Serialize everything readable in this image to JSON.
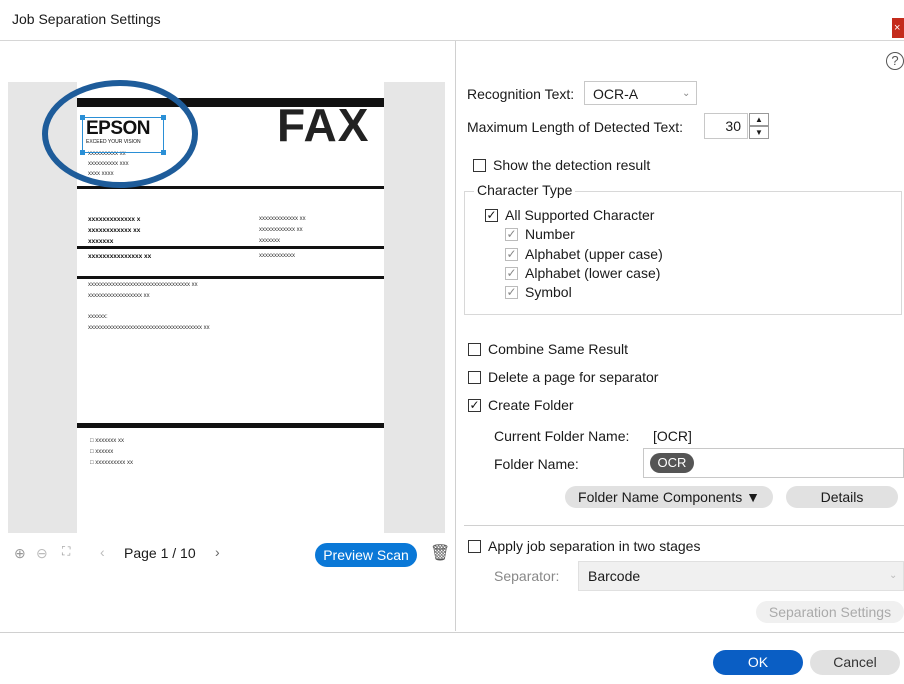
{
  "window": {
    "title": "Job Separation Settings",
    "close_glyph": "×"
  },
  "preview": {
    "fax_heading": "FAX",
    "logo_text": "EPSON",
    "logo_tagline": "EXCEED YOUR VISION",
    "lines": {
      "l1": "xxxxxxxxxx xx",
      "l2": "xxxxxxxxxx xxx",
      "l3": "xxxx xxxx",
      "b1": "xxxxxxxxxxxxx x",
      "b2": "xxxxxxxxxxxx xx",
      "b3": "xxxxxxx",
      "b4": "xxxxxxxxxxxxxxx xx",
      "r1": "xxxxxxxxxxxxx xx",
      "r2": "xxxxxxxxxxxx xx",
      "r3": "xxxxxxx",
      "r4": "xxxxxxxxxxxx",
      "p1": "xxxxxxxxxxxxxxxxxxxxxxxxxxxxxxxxxx xx",
      "p2": "xxxxxxxxxxxxxxxxxx xx",
      "p3": "xxxxxx:",
      "p4": "xxxxxxxxxxxxxxxxxxxxxxxxxxxxxxxxxxxxxx xx",
      "c1": "□ xxxxxxx xx",
      "c2": "□ xxxxxx",
      "c3": "□ xxxxxxxxxx xx"
    },
    "page_label": "Page 1 / 10",
    "preview_scan_label": "Preview Scan"
  },
  "settings": {
    "recognition_text_label": "Recognition Text:",
    "recognition_text_value": "OCR-A",
    "max_length_label": "Maximum Length of Detected Text:",
    "max_length_value": "30",
    "show_detection_label": "Show the detection result",
    "character_type": {
      "group_label": "Character Type",
      "all_label": "All Supported Character",
      "number_label": "Number",
      "upper_label": "Alphabet (upper case)",
      "lower_label": "Alphabet (lower case)",
      "symbol_label": "Symbol"
    },
    "combine_label": "Combine Same Result",
    "delete_page_label": "Delete a page for separator",
    "create_folder_label": "Create Folder",
    "current_folder_label": "Current Folder Name:",
    "current_folder_value": "[OCR]",
    "folder_name_label": "Folder Name:",
    "folder_name_chip": "OCR",
    "folder_components_label": "Folder Name Components ▼",
    "details_label": "Details",
    "two_stages_label": "Apply job separation in two stages",
    "separator_label": "Separator:",
    "separator_value": "Barcode",
    "separation_settings_label": "Separation Settings"
  },
  "footer": {
    "ok_label": "OK",
    "cancel_label": "Cancel"
  },
  "colors": {
    "accent": "#0a78d7",
    "ok": "#0a5ec4",
    "logo_ring": "#1e5c9a"
  }
}
